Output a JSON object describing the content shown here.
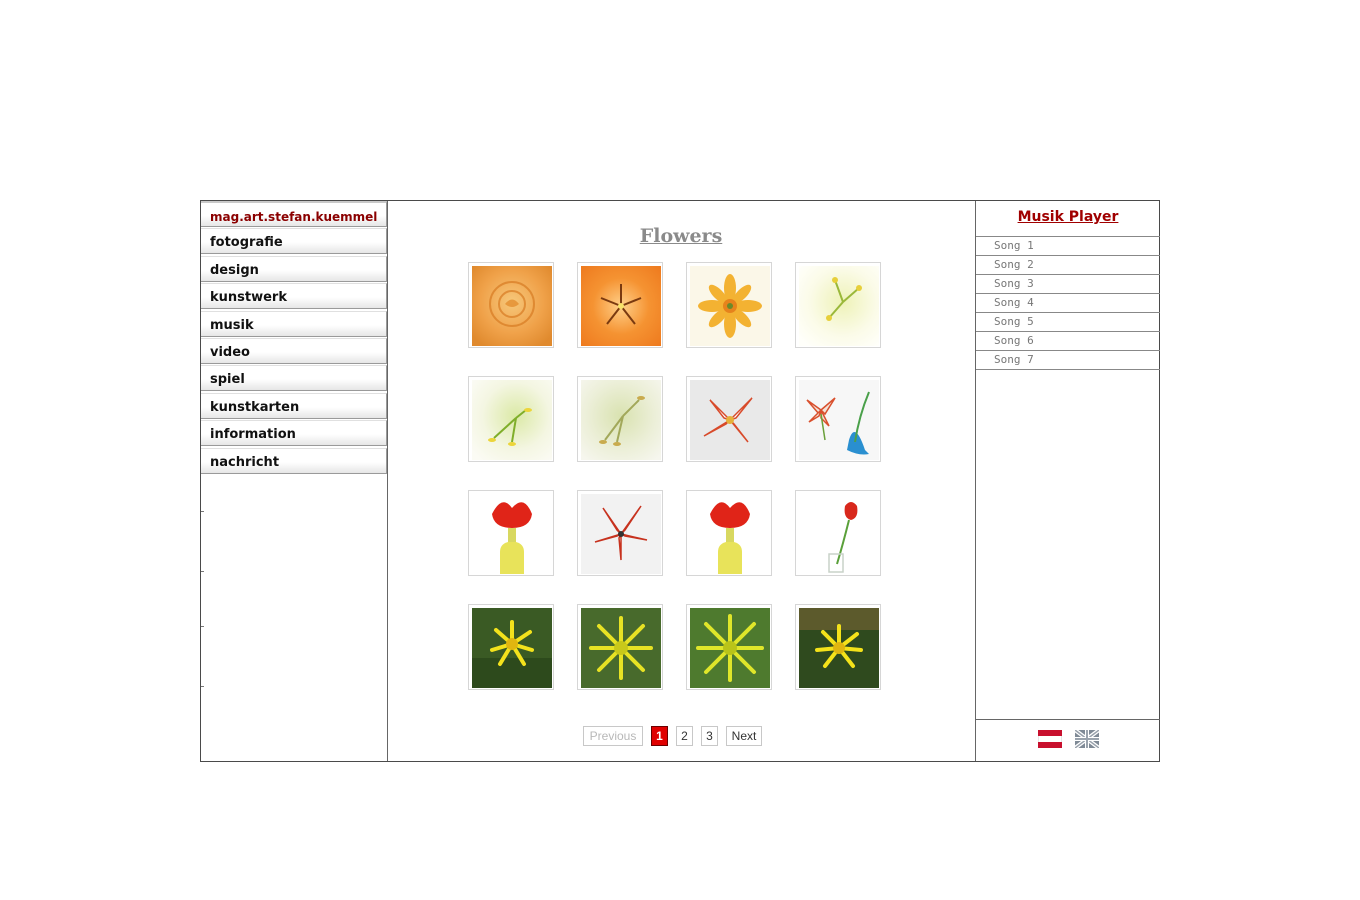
{
  "nav": {
    "items": [
      {
        "label": "mag.art.stefan.kuemmel"
      },
      {
        "label": "fotografie"
      },
      {
        "label": "design"
      },
      {
        "label": "kunstwerk"
      },
      {
        "label": "musik"
      },
      {
        "label": "video"
      },
      {
        "label": "spiel"
      },
      {
        "label": "kunstkarten"
      },
      {
        "label": "information"
      },
      {
        "label": "nachricht"
      }
    ]
  },
  "gallery": {
    "title": "Flowers",
    "thumbnails": [
      {
        "icon": "orange-rose"
      },
      {
        "icon": "orange-lily"
      },
      {
        "icon": "yellow-star-flower"
      },
      {
        "icon": "white-lily"
      },
      {
        "icon": "white-lily-stamens"
      },
      {
        "icon": "white-lily-pale"
      },
      {
        "icon": "red-white-tulip"
      },
      {
        "icon": "tulip-blue-vase"
      },
      {
        "icon": "red-tulip-yellow-vase"
      },
      {
        "icon": "red-white-tulip-open"
      },
      {
        "icon": "red-tulip-yellow-vase"
      },
      {
        "icon": "red-tulip-glass-vase"
      },
      {
        "icon": "yellow-dandelion"
      },
      {
        "icon": "yellow-dandelion"
      },
      {
        "icon": "yellow-dandelion"
      },
      {
        "icon": "yellow-dandelion"
      }
    ]
  },
  "pager": {
    "previous": "Previous",
    "pages": [
      "1",
      "2",
      "3"
    ],
    "current": "1",
    "next": "Next"
  },
  "player": {
    "title": "Musik Player",
    "songs": [
      "Song 1",
      "Song 2",
      "Song 3",
      "Song 4",
      "Song 5",
      "Song 6",
      "Song 7"
    ]
  },
  "languages": [
    {
      "icon": "austria-flag-icon"
    },
    {
      "icon": "uk-flag-icon"
    }
  ],
  "colors": {
    "accent": "#a00000",
    "active_page": "#e00000"
  }
}
